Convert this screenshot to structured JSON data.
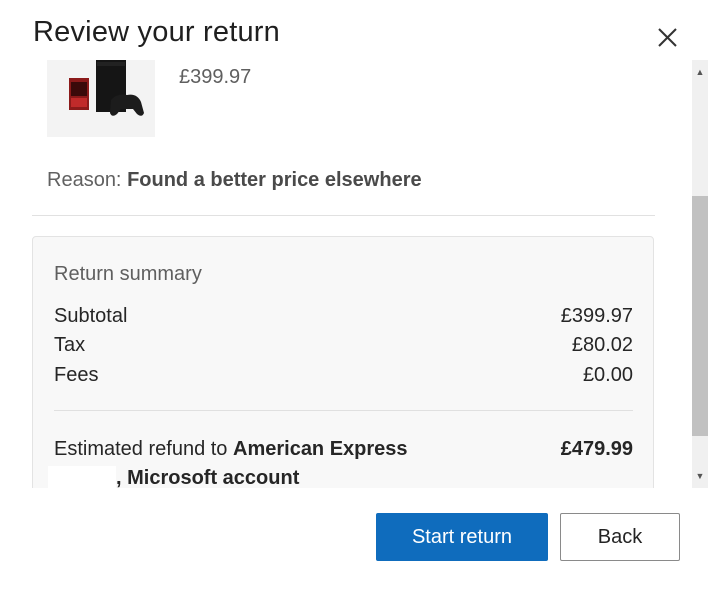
{
  "dialog": {
    "title": "Review your return",
    "close_icon": "close-icon"
  },
  "item": {
    "image": "xbox-console-bundle-image",
    "price": "£399.97"
  },
  "reason": {
    "label": "Reason:",
    "value": "Found a better price elsewhere"
  },
  "summary": {
    "title": "Return summary",
    "rows": [
      {
        "label": "Subtotal",
        "amount": "£399.97"
      },
      {
        "label": "Tax",
        "amount": "£80.02"
      },
      {
        "label": "Fees",
        "amount": "£0.00"
      }
    ],
    "refund_prefix": "Estimated refund to",
    "refund_method": "American Express",
    "refund_account": ", Microsoft account",
    "refund_amount": "£479.99"
  },
  "buttons": {
    "start_return": "Start return",
    "back": "Back"
  },
  "colors": {
    "primary": "#0f6cbd",
    "card_bg": "#f8f8f8"
  }
}
